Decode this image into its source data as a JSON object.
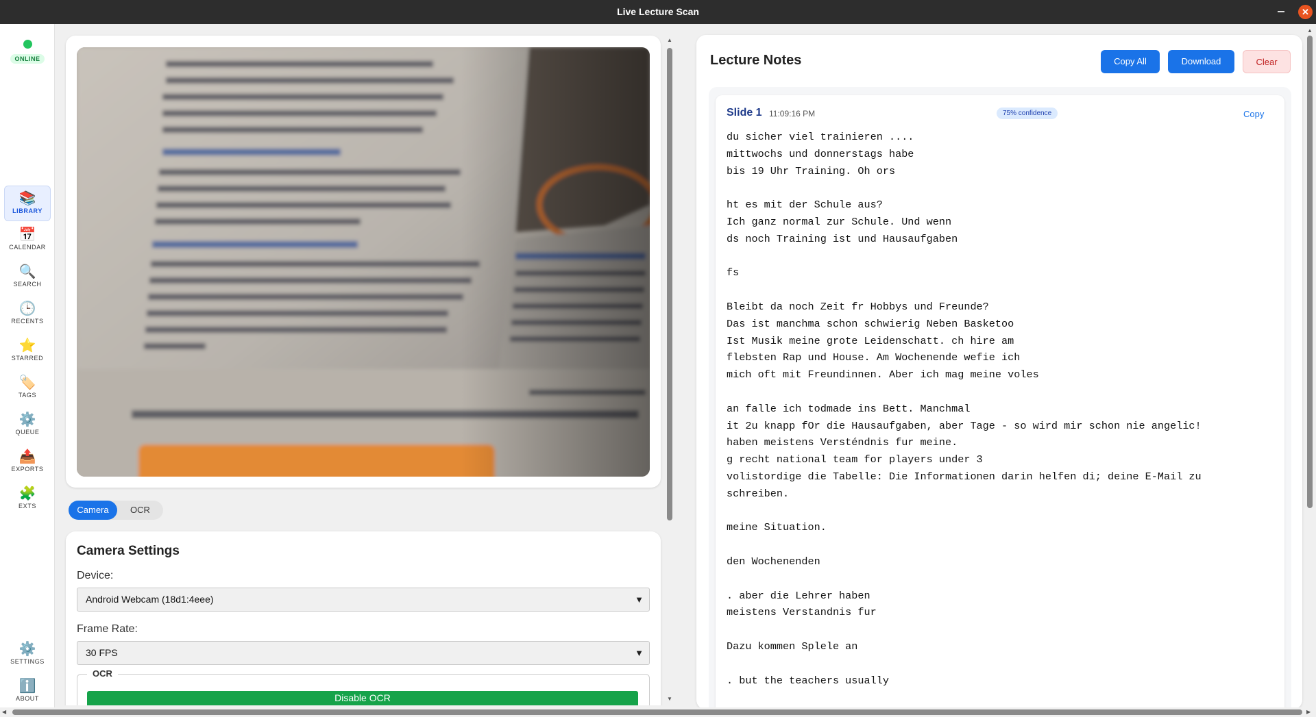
{
  "window": {
    "title": "Live Lecture Scan",
    "minimize_icon": "minimize-icon",
    "close_icon": "close-icon",
    "close_glyph": "✕"
  },
  "status": {
    "label": "ONLINE",
    "color": "#22c55e"
  },
  "sidebar": {
    "items": [
      {
        "id": "library",
        "label": "LIBRARY",
        "icon": "📚",
        "active": true
      },
      {
        "id": "calendar",
        "label": "CALENDAR",
        "icon": "📅"
      },
      {
        "id": "search",
        "label": "SEARCH",
        "icon": "🔍"
      },
      {
        "id": "recents",
        "label": "RECENTS",
        "icon": "🕒"
      },
      {
        "id": "starred",
        "label": "STARRED",
        "icon": "⭐"
      },
      {
        "id": "tags",
        "label": "TAGS",
        "icon": "🏷️"
      },
      {
        "id": "queue",
        "label": "QUEUE",
        "icon": "⚙️"
      },
      {
        "id": "exports",
        "label": "EXPORTS",
        "icon": "📤"
      },
      {
        "id": "exts",
        "label": "EXTS",
        "icon": "🧩"
      }
    ],
    "bottom_items": [
      {
        "id": "settings",
        "label": "SETTINGS",
        "icon": "⚙️"
      },
      {
        "id": "about",
        "label": "ABOUT",
        "icon": "ℹ️"
      }
    ]
  },
  "tabs": {
    "camera": "Camera",
    "ocr": "OCR",
    "active": "camera"
  },
  "camera_settings": {
    "title": "Camera Settings",
    "device_label": "Device:",
    "device_value": "Android Webcam (18d1:4eee)",
    "frame_rate_label": "Frame Rate:",
    "frame_rate_value": "30 FPS",
    "ocr_legend": "OCR",
    "ocr_button": "Disable OCR"
  },
  "notes": {
    "title": "Lecture Notes",
    "copy_all": "Copy All",
    "download": "Download",
    "clear": "Clear",
    "slide": {
      "title": "Slide 1",
      "time": "11:09:16 PM",
      "confidence": "75% confidence",
      "copy": "Copy",
      "text": "du sicher viel trainieren ....\nmittwochs und donnerstags habe\nbis 19 Uhr Training. Oh ors\n\nht es mit der Schule aus?\nIch ganz normal zur Schule. Und wenn\nds noch Training ist und Hausaufgaben\n\nfs\n\nBleibt da noch Zeit fr Hobbys und Freunde?\nDas ist manchma schon schwierig Neben Basketoo\nIst Musik meine grote Leidenschatt. ch hire am\nflebsten Rap und House. Am Wochenende wefie ich\nmich oft mit Freundinnen. Aber ich mag meine voles\n\nan falle ich todmade ins Bett. Manchmal\nit 2u knapp fOr die Hausaufgaben, aber Tage - so wird mir schon nie angelic!\nhaben meistens Versténdnis fur meine.\ng recht national team for players under 3\nvolistordige die Tabelle: Die Informationen darin helfen di; deine E-Mail zu\nschreiben.\n\nmeine Situation.\n\nden Wochenenden\n\n. aber die Lehrer haben\nmeistens Verstandnis fur\n\nDazu kommen Splele an\n\n. but the teachers usually"
    }
  }
}
